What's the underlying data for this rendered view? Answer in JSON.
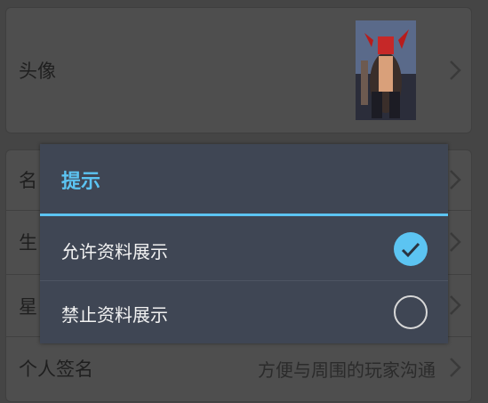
{
  "profile": {
    "avatar_label": "头像",
    "rows": [
      {
        "label": "名"
      },
      {
        "label": "生"
      },
      {
        "label": "星"
      },
      {
        "label": "个人签名",
        "value": "方便与周围的玩家沟通"
      }
    ]
  },
  "dialog": {
    "title": "提示",
    "options": [
      {
        "label": "允许资料展示",
        "selected": true
      },
      {
        "label": "禁止资料展示",
        "selected": false
      }
    ]
  },
  "colors": {
    "accent": "#5cc4f2",
    "dialog_bg": "#3f4654"
  },
  "icons": {
    "row_arrow": "chevron-right-icon",
    "selected": "check-circle-icon",
    "unselected": "empty-circle-icon"
  }
}
